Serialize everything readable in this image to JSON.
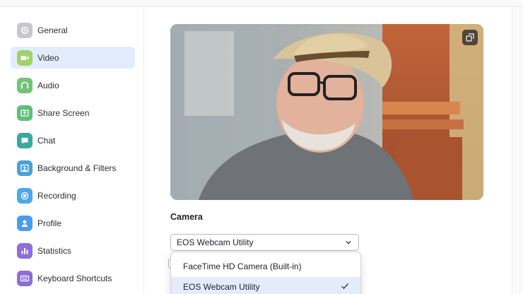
{
  "sidebar": {
    "items": [
      {
        "label": "General",
        "icon": "gear-icon",
        "color": "#c7c7cc",
        "active": false
      },
      {
        "label": "Video",
        "icon": "video-camera-icon",
        "color": "#9ed36a",
        "active": true
      },
      {
        "label": "Audio",
        "icon": "headphones-icon",
        "color": "#74c377",
        "active": false
      },
      {
        "label": "Share Screen",
        "icon": "share-screen-icon",
        "color": "#5ec07a",
        "active": false
      },
      {
        "label": "Chat",
        "icon": "chat-bubble-icon",
        "color": "#3aa9a0",
        "active": false
      },
      {
        "label": "Background & Filters",
        "icon": "background-image-icon",
        "color": "#4aa3d6",
        "active": false
      },
      {
        "label": "Recording",
        "icon": "record-icon",
        "color": "#4ea8e6",
        "active": false
      },
      {
        "label": "Profile",
        "icon": "person-icon",
        "color": "#4d9ce8",
        "active": false
      },
      {
        "label": "Statistics",
        "icon": "bar-chart-icon",
        "color": "#8e6fd8",
        "active": false
      },
      {
        "label": "Keyboard Shortcuts",
        "icon": "keyboard-icon",
        "color": "#8b6fd4",
        "active": false
      }
    ]
  },
  "video": {
    "preview_icon": "picture-in-picture-icon",
    "camera_label": "Camera",
    "camera_selected": "EOS Webcam Utility",
    "options": [
      {
        "label": "FaceTime HD Camera (Built-in)",
        "selected": false
      },
      {
        "label": "EOS Webcam Utility",
        "selected": true
      }
    ]
  },
  "colors": {
    "accent": "#0e72ed",
    "active_bg": "#e3ecfa"
  }
}
